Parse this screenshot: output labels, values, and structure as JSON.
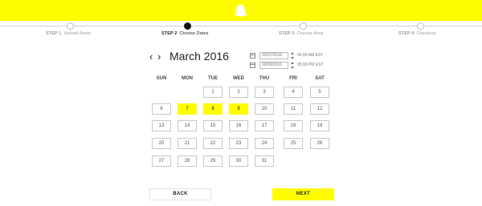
{
  "header": {
    "logo_icon": "ghost-icon",
    "brand_color": "#fffc00"
  },
  "steps": [
    {
      "num": "STEP 1",
      "label": "Upload Asset",
      "active": false
    },
    {
      "num": "STEP 2",
      "label": "Choose Dates",
      "active": true
    },
    {
      "num": "STEP 3",
      "label": "Choose Area",
      "active": false
    },
    {
      "num": "STEP 4",
      "label": "Checkout",
      "active": false
    }
  ],
  "calendar": {
    "month_title": "March 2016",
    "prev_icon": "chevron-left-icon",
    "next_icon": "chevron-right-icon",
    "weekdays": [
      "SUN",
      "MON",
      "TUE",
      "WED",
      "THU",
      "FRI",
      "SAT"
    ],
    "days": [
      "1",
      "2",
      "3",
      "4",
      "5",
      "6",
      "7",
      "8",
      "9",
      "10",
      "11",
      "12",
      "13",
      "14",
      "15",
      "16",
      "17",
      "18",
      "19",
      "20",
      "21",
      "22",
      "23",
      "24",
      "25",
      "26",
      "27",
      "28",
      "29",
      "30",
      "31"
    ],
    "first_weekday_index": 2,
    "selected_days": [
      "7",
      "8",
      "9"
    ]
  },
  "range": {
    "start": {
      "date": "03/07/2016",
      "time": "05:00 AM EST"
    },
    "end": {
      "date": "03/09/2016",
      "time": "05:00 PM EST"
    }
  },
  "buttons": {
    "back": "BACK",
    "next": "NEXT"
  }
}
